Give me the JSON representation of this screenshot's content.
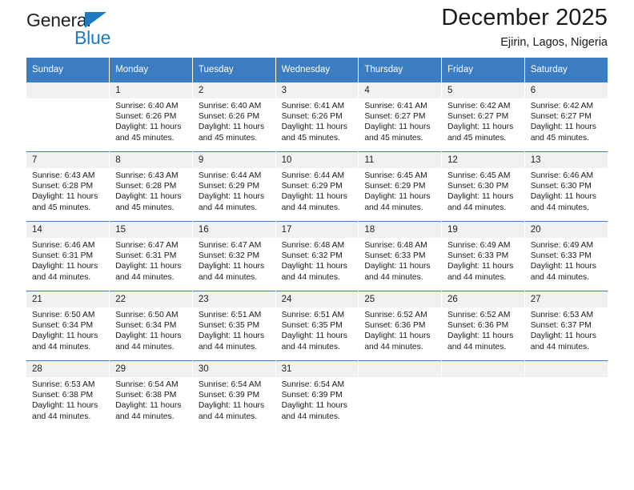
{
  "brand": {
    "name_part1": "General",
    "name_part2": "Blue",
    "accent_color": "#1f7ac4"
  },
  "header": {
    "title": "December 2025",
    "subtitle": "Ejirin, Lagos, Nigeria",
    "header_bg_color": "#3b7dc0",
    "daynum_bg_color": "#f1f1f1"
  },
  "weekdays": [
    "Sunday",
    "Monday",
    "Tuesday",
    "Wednesday",
    "Thursday",
    "Friday",
    "Saturday"
  ],
  "weeks": [
    [
      {
        "day": "",
        "sunrise": "",
        "sunset": "",
        "daylight_line1": "",
        "daylight_line2": "",
        "blank": true
      },
      {
        "day": "1",
        "sunrise": "Sunrise: 6:40 AM",
        "sunset": "Sunset: 6:26 PM",
        "daylight_line1": "Daylight: 11 hours",
        "daylight_line2": "and 45 minutes."
      },
      {
        "day": "2",
        "sunrise": "Sunrise: 6:40 AM",
        "sunset": "Sunset: 6:26 PM",
        "daylight_line1": "Daylight: 11 hours",
        "daylight_line2": "and 45 minutes."
      },
      {
        "day": "3",
        "sunrise": "Sunrise: 6:41 AM",
        "sunset": "Sunset: 6:26 PM",
        "daylight_line1": "Daylight: 11 hours",
        "daylight_line2": "and 45 minutes."
      },
      {
        "day": "4",
        "sunrise": "Sunrise: 6:41 AM",
        "sunset": "Sunset: 6:27 PM",
        "daylight_line1": "Daylight: 11 hours",
        "daylight_line2": "and 45 minutes."
      },
      {
        "day": "5",
        "sunrise": "Sunrise: 6:42 AM",
        "sunset": "Sunset: 6:27 PM",
        "daylight_line1": "Daylight: 11 hours",
        "daylight_line2": "and 45 minutes."
      },
      {
        "day": "6",
        "sunrise": "Sunrise: 6:42 AM",
        "sunset": "Sunset: 6:27 PM",
        "daylight_line1": "Daylight: 11 hours",
        "daylight_line2": "and 45 minutes."
      }
    ],
    [
      {
        "day": "7",
        "sunrise": "Sunrise: 6:43 AM",
        "sunset": "Sunset: 6:28 PM",
        "daylight_line1": "Daylight: 11 hours",
        "daylight_line2": "and 45 minutes."
      },
      {
        "day": "8",
        "sunrise": "Sunrise: 6:43 AM",
        "sunset": "Sunset: 6:28 PM",
        "daylight_line1": "Daylight: 11 hours",
        "daylight_line2": "and 45 minutes."
      },
      {
        "day": "9",
        "sunrise": "Sunrise: 6:44 AM",
        "sunset": "Sunset: 6:29 PM",
        "daylight_line1": "Daylight: 11 hours",
        "daylight_line2": "and 44 minutes."
      },
      {
        "day": "10",
        "sunrise": "Sunrise: 6:44 AM",
        "sunset": "Sunset: 6:29 PM",
        "daylight_line1": "Daylight: 11 hours",
        "daylight_line2": "and 44 minutes."
      },
      {
        "day": "11",
        "sunrise": "Sunrise: 6:45 AM",
        "sunset": "Sunset: 6:29 PM",
        "daylight_line1": "Daylight: 11 hours",
        "daylight_line2": "and 44 minutes."
      },
      {
        "day": "12",
        "sunrise": "Sunrise: 6:45 AM",
        "sunset": "Sunset: 6:30 PM",
        "daylight_line1": "Daylight: 11 hours",
        "daylight_line2": "and 44 minutes."
      },
      {
        "day": "13",
        "sunrise": "Sunrise: 6:46 AM",
        "sunset": "Sunset: 6:30 PM",
        "daylight_line1": "Daylight: 11 hours",
        "daylight_line2": "and 44 minutes."
      }
    ],
    [
      {
        "day": "14",
        "sunrise": "Sunrise: 6:46 AM",
        "sunset": "Sunset: 6:31 PM",
        "daylight_line1": "Daylight: 11 hours",
        "daylight_line2": "and 44 minutes."
      },
      {
        "day": "15",
        "sunrise": "Sunrise: 6:47 AM",
        "sunset": "Sunset: 6:31 PM",
        "daylight_line1": "Daylight: 11 hours",
        "daylight_line2": "and 44 minutes."
      },
      {
        "day": "16",
        "sunrise": "Sunrise: 6:47 AM",
        "sunset": "Sunset: 6:32 PM",
        "daylight_line1": "Daylight: 11 hours",
        "daylight_line2": "and 44 minutes."
      },
      {
        "day": "17",
        "sunrise": "Sunrise: 6:48 AM",
        "sunset": "Sunset: 6:32 PM",
        "daylight_line1": "Daylight: 11 hours",
        "daylight_line2": "and 44 minutes."
      },
      {
        "day": "18",
        "sunrise": "Sunrise: 6:48 AM",
        "sunset": "Sunset: 6:33 PM",
        "daylight_line1": "Daylight: 11 hours",
        "daylight_line2": "and 44 minutes."
      },
      {
        "day": "19",
        "sunrise": "Sunrise: 6:49 AM",
        "sunset": "Sunset: 6:33 PM",
        "daylight_line1": "Daylight: 11 hours",
        "daylight_line2": "and 44 minutes."
      },
      {
        "day": "20",
        "sunrise": "Sunrise: 6:49 AM",
        "sunset": "Sunset: 6:33 PM",
        "daylight_line1": "Daylight: 11 hours",
        "daylight_line2": "and 44 minutes."
      }
    ],
    [
      {
        "day": "21",
        "sunrise": "Sunrise: 6:50 AM",
        "sunset": "Sunset: 6:34 PM",
        "daylight_line1": "Daylight: 11 hours",
        "daylight_line2": "and 44 minutes."
      },
      {
        "day": "22",
        "sunrise": "Sunrise: 6:50 AM",
        "sunset": "Sunset: 6:34 PM",
        "daylight_line1": "Daylight: 11 hours",
        "daylight_line2": "and 44 minutes."
      },
      {
        "day": "23",
        "sunrise": "Sunrise: 6:51 AM",
        "sunset": "Sunset: 6:35 PM",
        "daylight_line1": "Daylight: 11 hours",
        "daylight_line2": "and 44 minutes."
      },
      {
        "day": "24",
        "sunrise": "Sunrise: 6:51 AM",
        "sunset": "Sunset: 6:35 PM",
        "daylight_line1": "Daylight: 11 hours",
        "daylight_line2": "and 44 minutes."
      },
      {
        "day": "25",
        "sunrise": "Sunrise: 6:52 AM",
        "sunset": "Sunset: 6:36 PM",
        "daylight_line1": "Daylight: 11 hours",
        "daylight_line2": "and 44 minutes."
      },
      {
        "day": "26",
        "sunrise": "Sunrise: 6:52 AM",
        "sunset": "Sunset: 6:36 PM",
        "daylight_line1": "Daylight: 11 hours",
        "daylight_line2": "and 44 minutes."
      },
      {
        "day": "27",
        "sunrise": "Sunrise: 6:53 AM",
        "sunset": "Sunset: 6:37 PM",
        "daylight_line1": "Daylight: 11 hours",
        "daylight_line2": "and 44 minutes."
      }
    ],
    [
      {
        "day": "28",
        "sunrise": "Sunrise: 6:53 AM",
        "sunset": "Sunset: 6:38 PM",
        "daylight_line1": "Daylight: 11 hours",
        "daylight_line2": "and 44 minutes."
      },
      {
        "day": "29",
        "sunrise": "Sunrise: 6:54 AM",
        "sunset": "Sunset: 6:38 PM",
        "daylight_line1": "Daylight: 11 hours",
        "daylight_line2": "and 44 minutes."
      },
      {
        "day": "30",
        "sunrise": "Sunrise: 6:54 AM",
        "sunset": "Sunset: 6:39 PM",
        "daylight_line1": "Daylight: 11 hours",
        "daylight_line2": "and 44 minutes."
      },
      {
        "day": "31",
        "sunrise": "Sunrise: 6:54 AM",
        "sunset": "Sunset: 6:39 PM",
        "daylight_line1": "Daylight: 11 hours",
        "daylight_line2": "and 44 minutes."
      },
      {
        "day": "",
        "sunrise": "",
        "sunset": "",
        "daylight_line1": "",
        "daylight_line2": "",
        "blank": true
      },
      {
        "day": "",
        "sunrise": "",
        "sunset": "",
        "daylight_line1": "",
        "daylight_line2": "",
        "blank": true
      },
      {
        "day": "",
        "sunrise": "",
        "sunset": "",
        "daylight_line1": "",
        "daylight_line2": "",
        "blank": true
      }
    ]
  ]
}
